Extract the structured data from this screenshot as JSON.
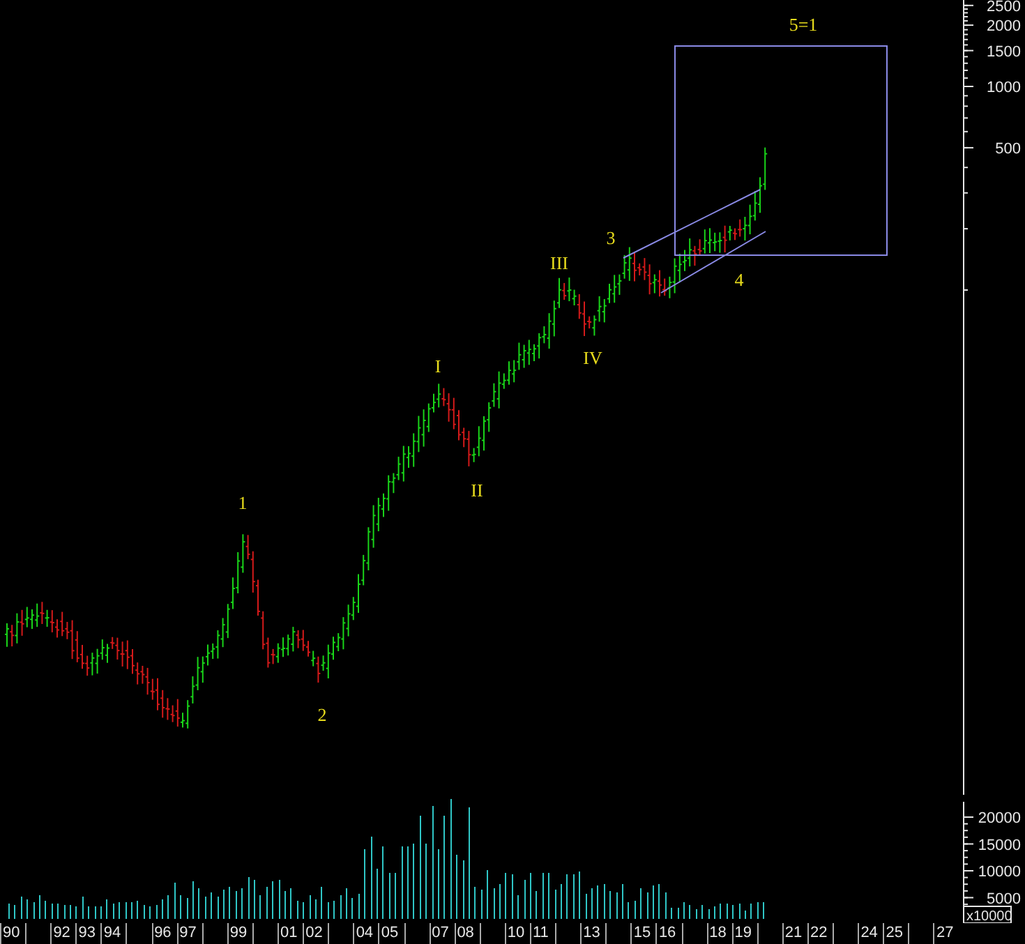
{
  "price_axis": {
    "labels": [
      "2500",
      "2000",
      "1500",
      "1000",
      "500"
    ]
  },
  "wave_labels": [
    {
      "text": "1"
    },
    {
      "text": "2"
    },
    {
      "text": "I"
    },
    {
      "text": "II"
    },
    {
      "text": "III"
    },
    {
      "text": "IV"
    },
    {
      "text": "3"
    },
    {
      "text": "4"
    },
    {
      "text": "5=1"
    }
  ],
  "volume_axis": {
    "labels": [
      "20000",
      "15000",
      "10000",
      "5000"
    ],
    "unit": "x10000"
  },
  "time_axis": {
    "cells": [
      {
        "kind": "label",
        "text": "90"
      },
      {
        "kind": "blank"
      },
      {
        "kind": "label",
        "text": "92"
      },
      {
        "kind": "label",
        "text": "93"
      },
      {
        "kind": "label",
        "text": "94"
      },
      {
        "kind": "blank"
      },
      {
        "kind": "label",
        "text": "96"
      },
      {
        "kind": "label",
        "text": "97"
      },
      {
        "kind": "blank"
      },
      {
        "kind": "label",
        "text": "99"
      },
      {
        "kind": "blank"
      },
      {
        "kind": "label",
        "text": "01"
      },
      {
        "kind": "label",
        "text": "02"
      },
      {
        "kind": "blank"
      },
      {
        "kind": "label",
        "text": "04"
      },
      {
        "kind": "label",
        "text": "05"
      },
      {
        "kind": "blank"
      },
      {
        "kind": "label",
        "text": "07"
      },
      {
        "kind": "label",
        "text": "08"
      },
      {
        "kind": "blank"
      },
      {
        "kind": "label",
        "text": "10"
      },
      {
        "kind": "label",
        "text": "11"
      },
      {
        "kind": "blank"
      },
      {
        "kind": "label",
        "text": "13"
      },
      {
        "kind": "blank"
      },
      {
        "kind": "label",
        "text": "15"
      },
      {
        "kind": "label",
        "text": "16"
      },
      {
        "kind": "blank"
      },
      {
        "kind": "label",
        "text": "18"
      },
      {
        "kind": "label",
        "text": "19"
      },
      {
        "kind": "blank"
      },
      {
        "kind": "label",
        "text": "21"
      },
      {
        "kind": "label",
        "text": "22"
      },
      {
        "kind": "blank"
      },
      {
        "kind": "label",
        "text": "24"
      },
      {
        "kind": "label",
        "text": "25"
      },
      {
        "kind": "blank"
      },
      {
        "kind": "label",
        "text": "27"
      }
    ]
  }
}
